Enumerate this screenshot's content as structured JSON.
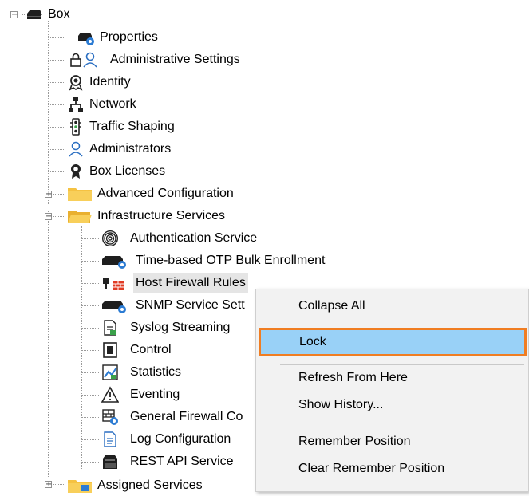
{
  "tree": {
    "root": {
      "label": "Box",
      "expander": "−",
      "icon": "box-icon"
    },
    "items": [
      {
        "label": "Properties",
        "icon": "box-properties-gear-icon"
      },
      {
        "label": "Administrative Settings",
        "icon": "lock-user-icon"
      },
      {
        "label": "Identity",
        "icon": "identity-badge-icon"
      },
      {
        "label": "Network",
        "icon": "network-icon"
      },
      {
        "label": "Traffic Shaping",
        "icon": "traffic-light-icon"
      },
      {
        "label": "Administrators",
        "icon": "administrator-user-icon"
      },
      {
        "label": "Box Licenses",
        "icon": "license-seal-icon"
      },
      {
        "label": "Advanced Configuration",
        "icon": "folder-icon",
        "expander": "+"
      },
      {
        "label": "Infrastructure Services",
        "icon": "folder-open-icon",
        "expander": "−"
      },
      {
        "label": "Assigned Services",
        "icon": "folder-services-icon",
        "expander": "+"
      }
    ],
    "children": [
      {
        "label": "Authentication Service",
        "icon": "fingerprint-icon"
      },
      {
        "label": "Time-based OTP Bulk Enrollment",
        "icon": "box-gear-icon"
      },
      {
        "label": "Host Firewall Rules",
        "icon": "host-firewall-icon"
      },
      {
        "label": "SNMP Service Sett",
        "icon": "box-gear-icon"
      },
      {
        "label": "Syslog Streaming",
        "icon": "syslog-document-icon"
      },
      {
        "label": "Control",
        "icon": "control-panel-icon"
      },
      {
        "label": "Statistics",
        "icon": "statistics-chart-icon"
      },
      {
        "label": "Eventing",
        "icon": "warning-triangle-icon"
      },
      {
        "label": "General Firewall Co",
        "icon": "firewall-grid-gear-icon"
      },
      {
        "label": "Log Configuration",
        "icon": "log-document-icon"
      },
      {
        "label": "REST API Service",
        "icon": "rest-api-icon"
      }
    ]
  },
  "context_menu": {
    "items": {
      "collapse_all": "Collapse All",
      "lock": "Lock",
      "refresh": "Refresh From Here",
      "show_history": "Show History...",
      "remember_position": "Remember Position",
      "clear_remember_position": "Clear Remember Position"
    }
  },
  "colors": {
    "folder": "#f5c242",
    "menu_highlight": "#99d1f7",
    "menu_focus_border": "#f07d22",
    "firewall_red": "#e03b24",
    "gear_blue": "#2b7bd3"
  }
}
